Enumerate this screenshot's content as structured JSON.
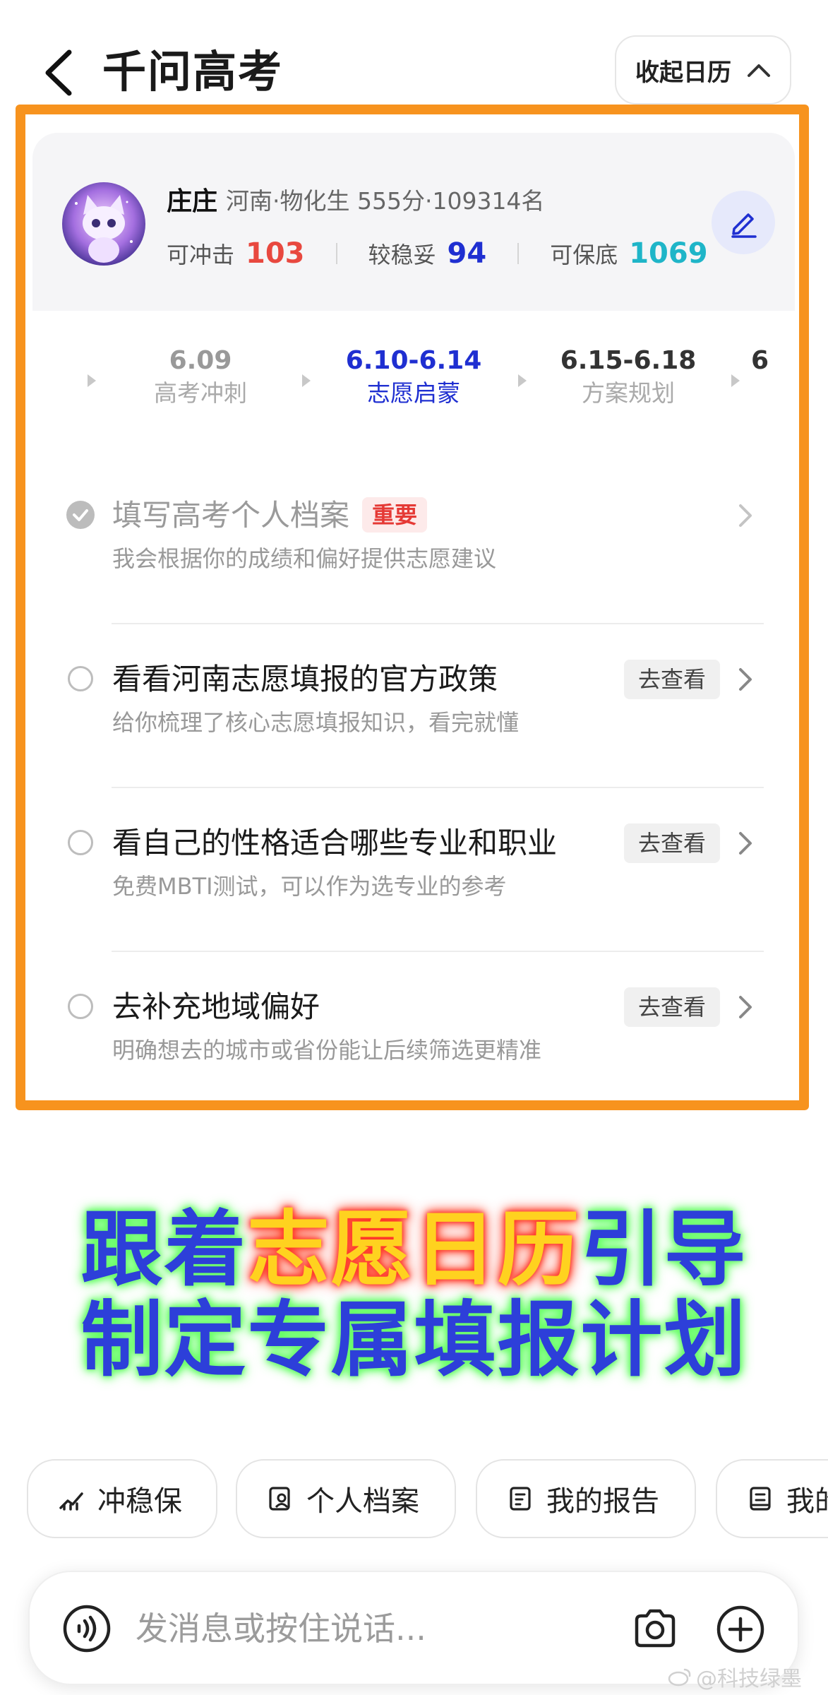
{
  "header": {
    "title": "千问高考",
    "collapse_label": "收起日历"
  },
  "profile": {
    "name": "庄庄",
    "info": "河南·物化生 555分·109314名",
    "stats": [
      {
        "label": "可冲击",
        "value": "103",
        "color": "#e8483f"
      },
      {
        "label": "较稳妥",
        "value": "94",
        "color": "#1f2fd1"
      },
      {
        "label": "可保底",
        "value": "1069",
        "color": "#1fb5c8"
      }
    ]
  },
  "timeline": [
    {
      "date": "6.09",
      "label": "高考冲刺",
      "state": "past"
    },
    {
      "date": "6.10-6.14",
      "label": "志愿启蒙",
      "state": "active"
    },
    {
      "date": "6.15-6.18",
      "label": "方案规划",
      "state": "future"
    },
    {
      "date": "6",
      "label": "",
      "state": "future"
    }
  ],
  "tasks": [
    {
      "title": "填写高考个人档案",
      "tag": "重要",
      "subtitle": "我会根据你的成绩和偏好提供志愿建议",
      "action": "",
      "done": true
    },
    {
      "title": "看看河南志愿填报的官方政策",
      "tag": "",
      "subtitle": "给你梳理了核心志愿填报知识，看完就懂",
      "action": "去查看",
      "done": false
    },
    {
      "title": "看自己的性格适合哪些专业和职业",
      "tag": "",
      "subtitle": "免费MBTI测试，可以作为选专业的参考",
      "action": "去查看",
      "done": false
    },
    {
      "title": "去补充地域偏好",
      "tag": "",
      "subtitle": "明确想去的城市或省份能让后续筛选更精准",
      "action": "去查看",
      "done": false
    }
  ],
  "caption": {
    "line1_prefix": "跟着",
    "line1_highlight": "志愿日历",
    "line1_suffix": "引导",
    "line2": "制定专属填报计划"
  },
  "chips": [
    {
      "label": "冲稳保",
      "icon": "trend-chart-icon"
    },
    {
      "label": "个人档案",
      "icon": "profile-card-icon"
    },
    {
      "label": "我的报告",
      "icon": "report-icon"
    },
    {
      "label": "我的",
      "icon": "document-icon"
    }
  ],
  "input": {
    "placeholder": "发消息或按住说话..."
  },
  "watermark": "@科技绿墨",
  "colors": {
    "accent_blue": "#1f2fd1",
    "frame_orange": "#f7931e",
    "important_red": "#e53935"
  }
}
